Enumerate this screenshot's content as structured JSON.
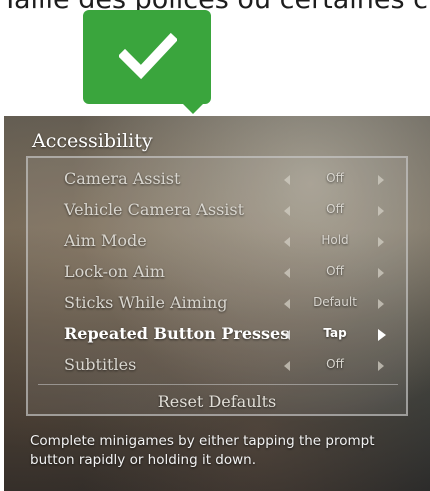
{
  "header": {
    "cropped_caption": "Taille des polices ou certaines c"
  },
  "bubble": {
    "icon": "check-icon",
    "color": "#3aa53d"
  },
  "menu": {
    "title": "Accessibility",
    "items": [
      {
        "label": "Camera Assist",
        "value": "Off",
        "selected": false
      },
      {
        "label": "Vehicle Camera Assist",
        "value": "Off",
        "selected": false
      },
      {
        "label": "Aim Mode",
        "value": "Hold",
        "selected": false
      },
      {
        "label": "Lock-on Aim",
        "value": "Off",
        "selected": false
      },
      {
        "label": "Sticks While Aiming",
        "value": "Default",
        "selected": false
      },
      {
        "label": "Repeated Button Presses",
        "value": "Tap",
        "selected": true
      },
      {
        "label": "Subtitles",
        "value": "Off",
        "selected": false
      }
    ],
    "reset_label": "Reset Defaults",
    "description": "Complete minigames by either tapping the prompt button rapidly or holding it down."
  }
}
